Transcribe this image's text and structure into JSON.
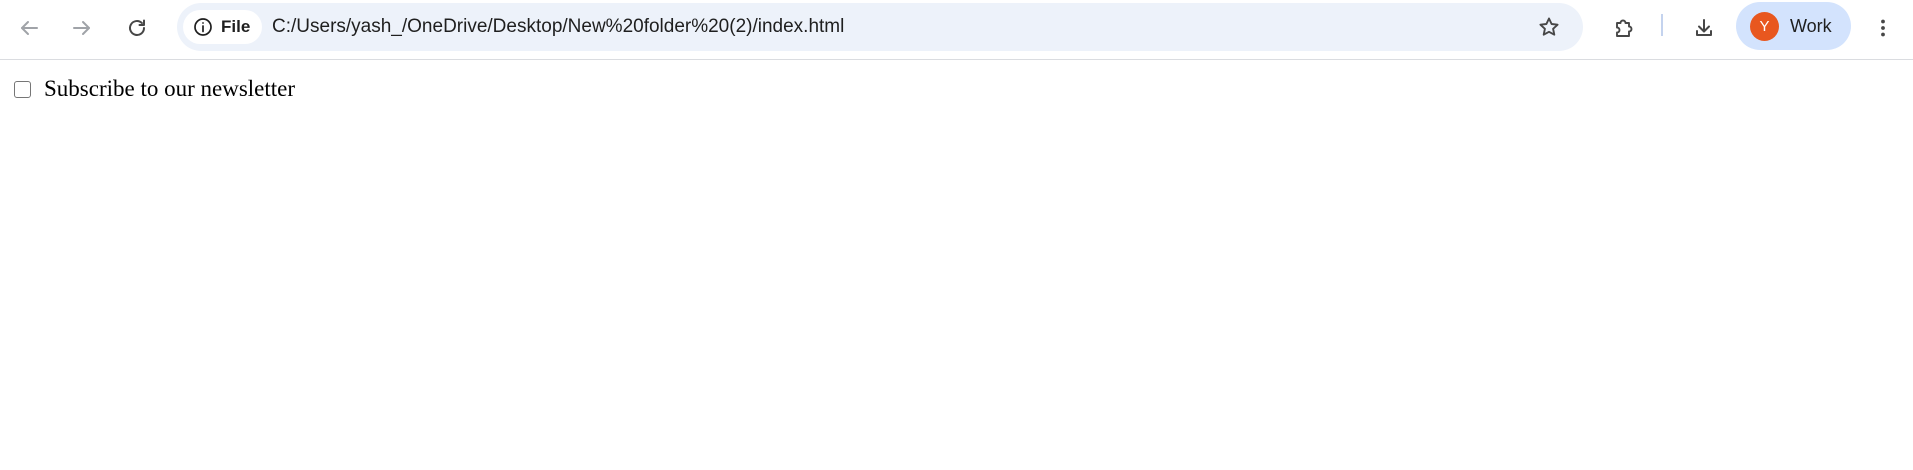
{
  "browser": {
    "site_chip_label": "File",
    "url": "C:/Users/yash_/OneDrive/Desktop/New%20folder%20(2)/index.html",
    "profile": {
      "initial": "Y",
      "label": "Work",
      "avatar_color": "#e8571f"
    },
    "icons": {
      "back": "arrow-left-icon",
      "forward": "arrow-right-icon",
      "reload": "reload-icon",
      "site_info": "info-circle-icon",
      "bookmark": "star-outline-icon",
      "extensions": "puzzle-icon",
      "downloads": "download-icon",
      "menu": "kebab-menu-icon"
    }
  },
  "page": {
    "checkbox": {
      "label": "Subscribe to our newsletter",
      "checked": false
    }
  }
}
